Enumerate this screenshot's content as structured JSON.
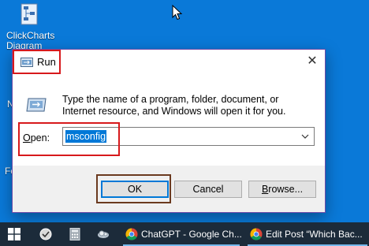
{
  "desktop": {
    "icon_label_line1": "ClickCharts",
    "icon_label_line2": "Diagram",
    "side_letter_1": "N",
    "side_letter_2": "Fo"
  },
  "dialog": {
    "title": "Run",
    "close_glyph": "✕",
    "description": "Type the name of a program, folder, document, or Internet resource, and Windows will open it for you.",
    "open_label_accel": "O",
    "open_label_rest": "pen:",
    "open_value": "msconfig",
    "buttons": {
      "ok": "OK",
      "cancel": "Cancel",
      "browse_accel": "B",
      "browse_rest": "rowse..."
    }
  },
  "taskbar": {
    "items": [
      {
        "name": "start",
        "icon": "windows-logo-icon"
      },
      {
        "name": "app-1",
        "icon": "app-icon"
      },
      {
        "name": "calculator",
        "icon": "calculator-icon"
      },
      {
        "name": "app-3",
        "icon": "settings-app-icon"
      },
      {
        "name": "chrome-1",
        "icon": "chrome-icon",
        "label": "ChatGPT - Google Ch..."
      },
      {
        "name": "chrome-2",
        "icon": "chrome-icon",
        "label": "Edit Post “Which Bac..."
      }
    ]
  },
  "colors": {
    "desktop_bg": "#0a79d8",
    "highlight_red": "#d7191c",
    "highlight_brown": "#6b3a1f",
    "selection_blue": "#0078d7",
    "taskbar_bg": "#1c2b3a"
  }
}
